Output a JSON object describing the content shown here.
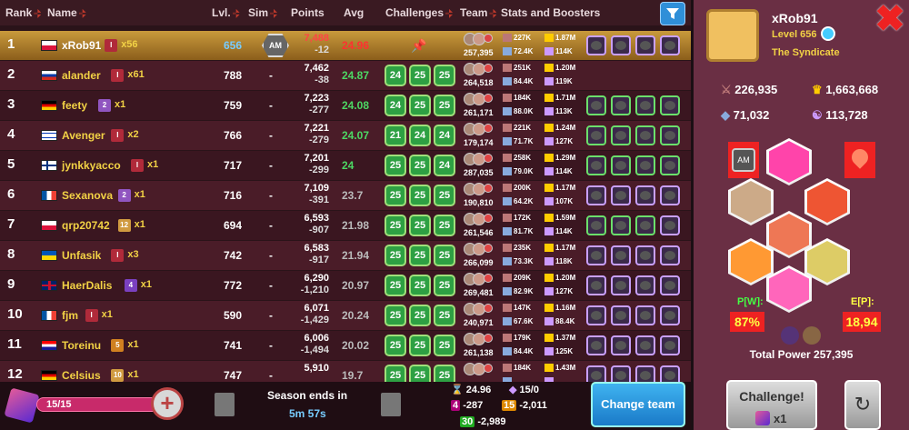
{
  "header": {
    "rank": "Rank",
    "name": "Name",
    "lvl": "Lvl.",
    "sim": "Sim",
    "points": "Points",
    "avg": "Avg",
    "challenges": "Challenges",
    "team": "Team",
    "stats": "Stats and Boosters"
  },
  "rows": [
    {
      "rank": "1",
      "flag": "pl",
      "name": "xRob91",
      "lg": "I",
      "mult": "x56",
      "lvl": "656",
      "sim": "",
      "pts": "7,488",
      "pd": "-12",
      "avg": "24.96",
      "ch": [],
      "tp": "257,395",
      "s1": "227K",
      "s2": "1.87M",
      "s3": "72.4K",
      "s4": "114K",
      "boost": [
        "p",
        "p",
        "p",
        "p"
      ]
    },
    {
      "rank": "2",
      "flag": "ru",
      "name": "alander",
      "lg": "I",
      "mult": "x61",
      "lvl": "788",
      "sim": "-",
      "pts": "7,462",
      "pd": "-38",
      "avg": "24.87",
      "ch": [
        "24",
        "25",
        "25"
      ],
      "tp": "264,518",
      "s1": "251K",
      "s2": "1.20M",
      "s3": "84.4K",
      "s4": "119K",
      "boost": []
    },
    {
      "rank": "3",
      "flag": "de",
      "name": "feety",
      "lg": "2",
      "mult": "x1",
      "lvl": "759",
      "sim": "-",
      "pts": "7,223",
      "pd": "-277",
      "avg": "24.08",
      "ch": [
        "24",
        "25",
        "25"
      ],
      "tp": "261,171",
      "s1": "184K",
      "s2": "1.71M",
      "s3": "88.0K",
      "s4": "113K",
      "boost": [
        "g",
        "g",
        "g",
        "g"
      ]
    },
    {
      "rank": "4",
      "flag": "il",
      "name": "Avenger",
      "lg": "I",
      "mult": "x2",
      "lvl": "766",
      "sim": "-",
      "pts": "7,221",
      "pd": "-279",
      "avg": "24.07",
      "ch": [
        "21",
        "24",
        "24"
      ],
      "tp": "179,174",
      "s1": "221K",
      "s2": "1.24M",
      "s3": "71.7K",
      "s4": "127K",
      "boost": [
        "g",
        "g",
        "g",
        "g"
      ]
    },
    {
      "rank": "5",
      "flag": "fi",
      "name": "jynkkyacco",
      "lg": "I",
      "mult": "x1",
      "lvl": "717",
      "sim": "-",
      "pts": "7,201",
      "pd": "-299",
      "avg": "24",
      "ch": [
        "25",
        "25",
        "24"
      ],
      "tp": "287,035",
      "s1": "258K",
      "s2": "1.29M",
      "s3": "79.0K",
      "s4": "114K",
      "boost": [
        "g",
        "g",
        "g",
        "g"
      ]
    },
    {
      "rank": "6",
      "flag": "fr",
      "name": "Sexanova",
      "lg": "2",
      "mult": "x1",
      "lvl": "716",
      "sim": "-",
      "pts": "7,109",
      "pd": "-391",
      "avg": "23.7",
      "ch": [
        "25",
        "25",
        "25"
      ],
      "tp": "190,810",
      "s1": "200K",
      "s2": "1.17M",
      "s3": "64.2K",
      "s4": "107K",
      "boost": [
        "p",
        "p",
        "p",
        "p"
      ]
    },
    {
      "rank": "7",
      "flag": "pl",
      "name": "qrp20742",
      "lg": "12",
      "mult": "x1",
      "lvl": "694",
      "sim": "-",
      "pts": "6,593",
      "pd": "-907",
      "avg": "21.98",
      "ch": [
        "25",
        "25",
        "25"
      ],
      "tp": "261,546",
      "s1": "172K",
      "s2": "1.59M",
      "s3": "81.7K",
      "s4": "114K",
      "boost": [
        "g",
        "g",
        "g",
        "p"
      ]
    },
    {
      "rank": "8",
      "flag": "ua",
      "name": "Unfasik",
      "lg": "I",
      "mult": "x3",
      "lvl": "742",
      "sim": "-",
      "pts": "6,583",
      "pd": "-917",
      "avg": "21.94",
      "ch": [
        "25",
        "25",
        "25"
      ],
      "tp": "266,099",
      "s1": "235K",
      "s2": "1.17M",
      "s3": "73.3K",
      "s4": "118K",
      "boost": [
        "p",
        "p",
        "p",
        "p"
      ]
    },
    {
      "rank": "9",
      "flag": "gb",
      "name": "HaerDalis",
      "lg": "4",
      "mult": "x1",
      "lvl": "772",
      "sim": "-",
      "pts": "6,290",
      "pd": "-1,210",
      "avg": "20.97",
      "ch": [
        "25",
        "25",
        "25"
      ],
      "tp": "269,481",
      "s1": "209K",
      "s2": "1.20M",
      "s3": "82.9K",
      "s4": "127K",
      "boost": [
        "p",
        "p",
        "p",
        "p"
      ]
    },
    {
      "rank": "10",
      "flag": "fr",
      "name": "fjm",
      "lg": "I",
      "mult": "x1",
      "lvl": "590",
      "sim": "-",
      "pts": "6,071",
      "pd": "-1,429",
      "avg": "20.24",
      "ch": [
        "25",
        "25",
        "25"
      ],
      "tp": "240,971",
      "s1": "147K",
      "s2": "1.16M",
      "s3": "67.6K",
      "s4": "88.4K",
      "boost": [
        "p",
        "p",
        "p",
        "p"
      ]
    },
    {
      "rank": "11",
      "flag": "hr",
      "name": "Toreinu",
      "lg": "5",
      "mult": "x1",
      "lvl": "741",
      "sim": "-",
      "pts": "6,006",
      "pd": "-1,494",
      "avg": "20.02",
      "ch": [
        "25",
        "25",
        "25"
      ],
      "tp": "261,138",
      "s1": "179K",
      "s2": "1.37M",
      "s3": "84.4K",
      "s4": "125K",
      "boost": [
        "p",
        "p",
        "p",
        "p"
      ]
    },
    {
      "rank": "12",
      "flag": "de",
      "name": "Celsius",
      "lg": "10",
      "mult": "x1",
      "lvl": "747",
      "sim": "-",
      "pts": "5,910",
      "pd": "",
      "avg": "19.7",
      "ch": [
        "25",
        "25",
        "25"
      ],
      "tp": "",
      "s1": "184K",
      "s2": "1.43M",
      "s3": "",
      "s4": "",
      "boost": [
        "p",
        "p",
        "p",
        "p"
      ]
    }
  ],
  "bottom": {
    "energy": "15/15",
    "season": "Season ends in",
    "timer": "5m 57s",
    "stat1": "24.96",
    "stat2": "15/0",
    "stat3": "-287",
    "stat4": "-2,011",
    "stat5": "-2,989",
    "change_team": "Change team",
    "b4": "4",
    "b15": "15",
    "b30": "30"
  },
  "profile": {
    "name": "xRob91",
    "level": "Level 656",
    "club": "The Syndicate",
    "s1": "226,935",
    "s2": "1,663,668",
    "s3": "71,032",
    "s4": "113,728",
    "pw_label": "P[W]:",
    "pw": "87%",
    "ep_label": "E[P]:",
    "ep": "18,94",
    "total": "Total Power 257,395",
    "challenge": "Challenge!",
    "cx": "x1",
    "am": "AM"
  }
}
